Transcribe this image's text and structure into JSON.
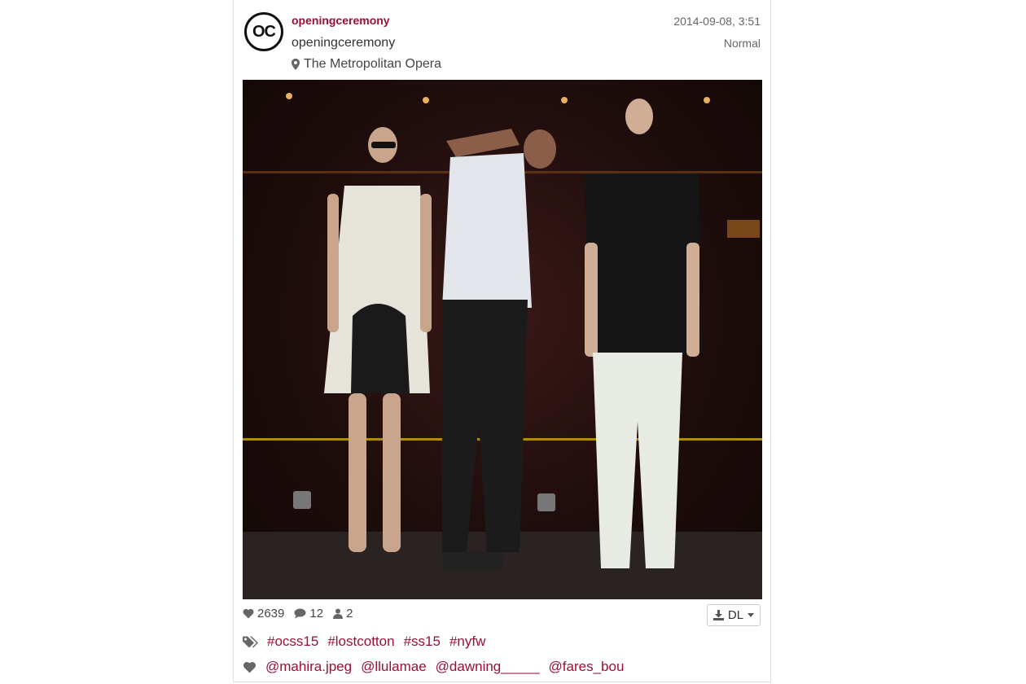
{
  "post": {
    "avatar_text": "OC",
    "username": "openingceremony",
    "full_name": "openingceremony",
    "location": "The Metropolitan Opera",
    "date": "2014-09-08, 3:51",
    "filter": "Normal"
  },
  "stats": {
    "likes": "2639",
    "comments": "12",
    "users": "2"
  },
  "download": {
    "label": "DL"
  },
  "hashtags": [
    "#ocss15",
    "#lostcotton",
    "#ss15",
    "#nyfw"
  ],
  "mentions": [
    "@mahira.jpeg",
    "@llulamae",
    "@dawning_____",
    "@fares_bou"
  ],
  "colors": {
    "accent": "#9a1035",
    "text": "#333333",
    "muted": "#666666"
  },
  "icons": {
    "location": "map-marker-icon",
    "likes": "heart-icon",
    "comments": "comment-icon",
    "users": "user-icon",
    "download": "download-icon",
    "tags": "tags-icon",
    "mentions": "heart-icon"
  }
}
